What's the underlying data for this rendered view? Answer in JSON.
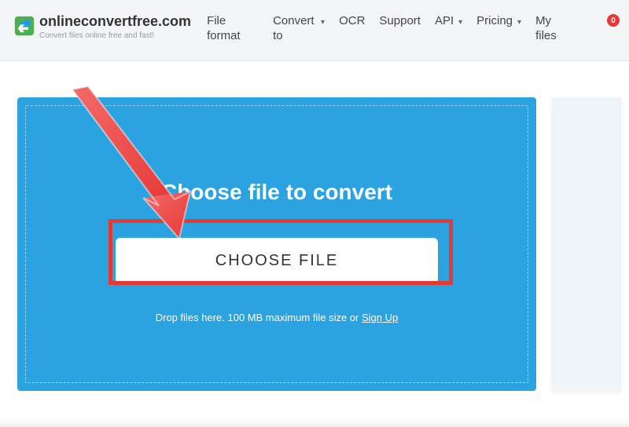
{
  "header": {
    "site_name": "onlineconvertfree.com",
    "tagline": "Convert files online free and fast!",
    "nav": {
      "file_format": "File format",
      "convert_to": "Convert to",
      "ocr": "OCR",
      "support": "Support",
      "api": "API",
      "pricing": "Pricing",
      "my_files": "My files"
    },
    "badge_count": "0"
  },
  "upload": {
    "headline": "Choose file to convert",
    "button_label": "CHOOSE FILE",
    "helper_prefix": "Drop files here. 100 MB maximum file size or ",
    "helper_link": "Sign Up"
  }
}
